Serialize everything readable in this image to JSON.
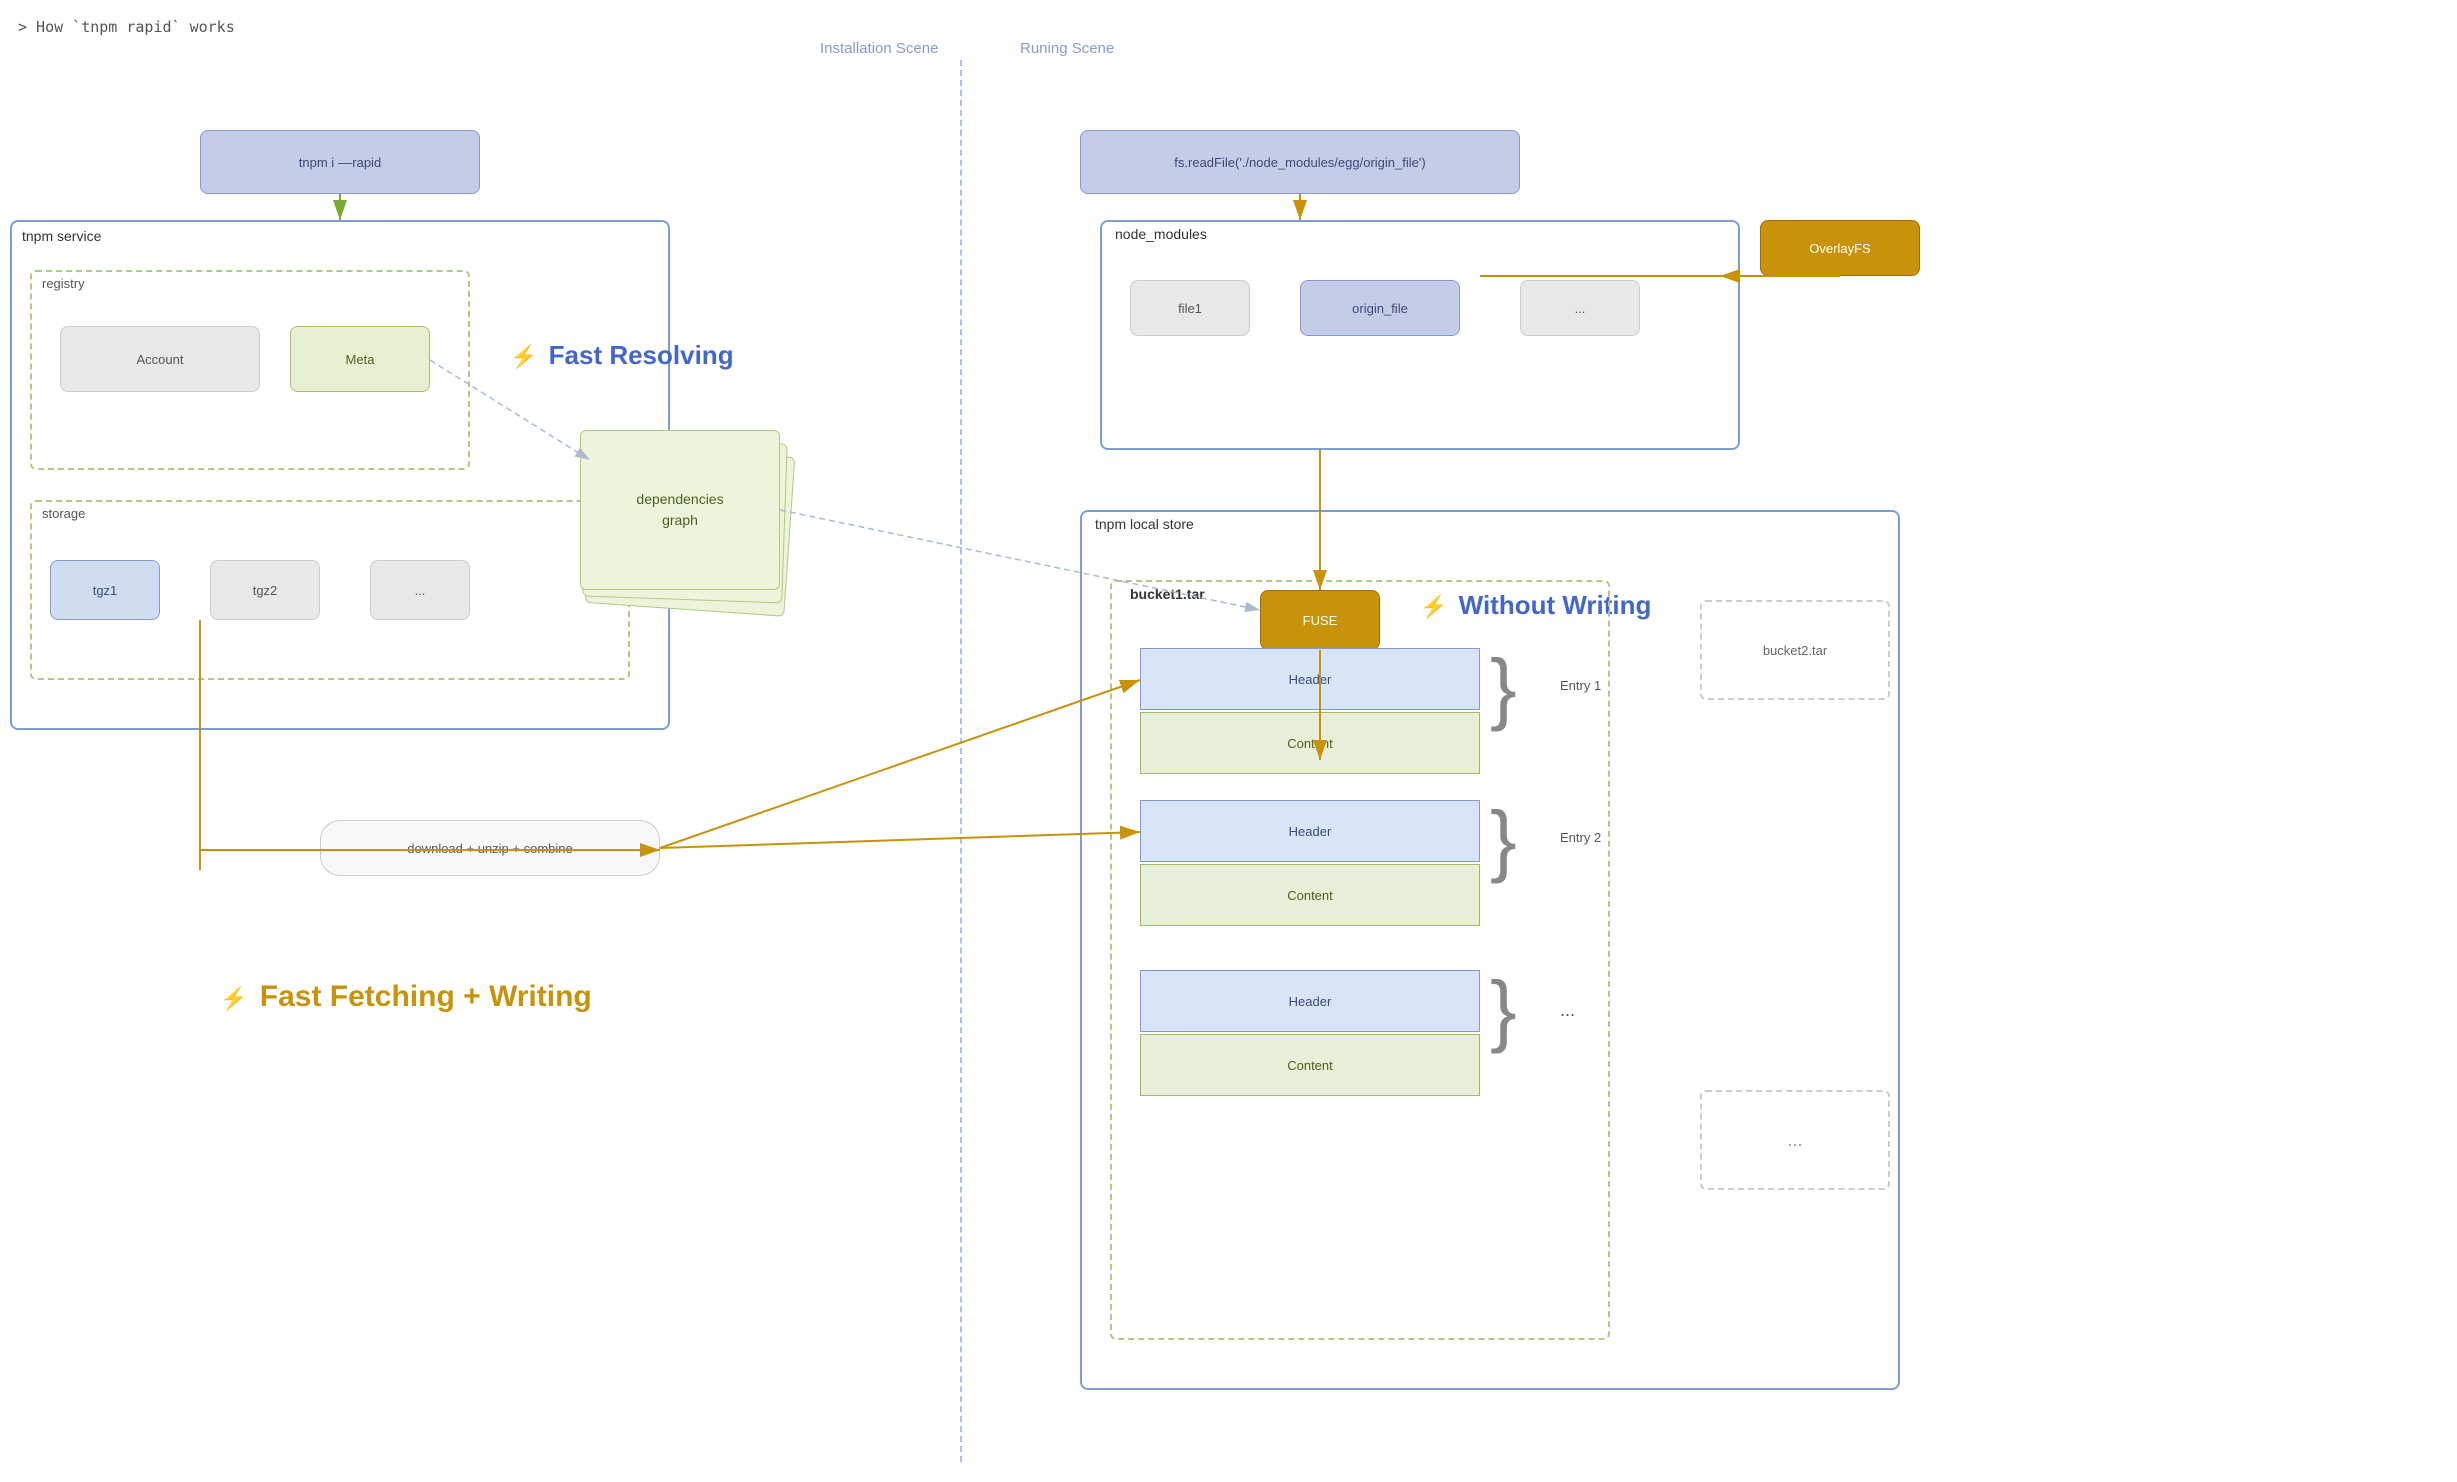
{
  "title": "> How `tnpm rapid` works",
  "scene_labels": {
    "installation": "Installation Scene",
    "running": "Runing Scene"
  },
  "tnpm_cmd": "tnpm i ––rapid",
  "fs_read": "fs.readFile('./node_modules/egg/origin_file')",
  "sections": {
    "tnpm_service": "tnpm service",
    "registry": "registry",
    "storage": "storage",
    "node_modules": "node_modules",
    "local_store": "tnpm local store",
    "bucket1": "bucket1.tar",
    "bucket2": "bucket2.tar"
  },
  "buttons": {
    "account": "Account",
    "meta": "Meta",
    "tgz1": "tgz1",
    "tgz2": "tgz2",
    "tgz_dots": "...",
    "file1": "file1",
    "origin_file": "origin_file",
    "nm_dots": "...",
    "overlayfs": "OverlayFS",
    "fuse": "FUSE"
  },
  "entries": {
    "header": "Header",
    "content": "Content",
    "entry1": "Entry 1",
    "entry2": "Entry 2",
    "entry3": "..."
  },
  "labels": {
    "deps_graph": "dependencies\ngraph",
    "download": "download + unzip + combine",
    "fast_resolving": "⚡ Fast Resolving",
    "without_writing": "⚡ Without Writing",
    "fast_fetching": "⚡ Fast Fetching + Writing"
  },
  "colors": {
    "purple_border": "#7b9fd4",
    "green_dashed": "#b0c980",
    "gold": "#c8920a",
    "blue_label": "#4466cc",
    "arrow_green": "#7aaa30",
    "arrow_gold": "#c8920a",
    "arrow_gray": "#aabbcc"
  }
}
